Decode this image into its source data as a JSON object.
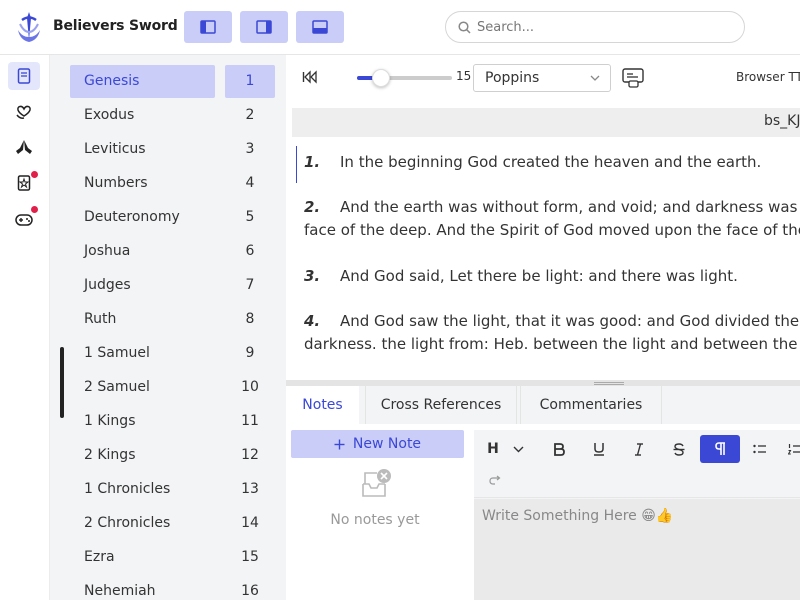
{
  "app": {
    "title": "Believers Sword"
  },
  "search": {
    "placeholder": "Search..."
  },
  "books": [
    {
      "name": "Genesis",
      "num": "1"
    },
    {
      "name": "Exodus",
      "num": "2"
    },
    {
      "name": "Leviticus",
      "num": "3"
    },
    {
      "name": "Numbers",
      "num": "4"
    },
    {
      "name": "Deuteronomy",
      "num": "5"
    },
    {
      "name": "Joshua",
      "num": "6"
    },
    {
      "name": "Judges",
      "num": "7"
    },
    {
      "name": "Ruth",
      "num": "8"
    },
    {
      "name": "1 Samuel",
      "num": "9"
    },
    {
      "name": "2 Samuel",
      "num": "10"
    },
    {
      "name": "1 Kings",
      "num": "11"
    },
    {
      "name": "2 Kings",
      "num": "12"
    },
    {
      "name": "1 Chronicles",
      "num": "13"
    },
    {
      "name": "2 Chronicles",
      "num": "14"
    },
    {
      "name": "Ezra",
      "num": "15"
    },
    {
      "name": "Nehemiah",
      "num": "16"
    }
  ],
  "reader": {
    "font_size": "15",
    "font_size_fraction": 0.25,
    "font_family": "Poppins",
    "tts_label": "Browser TTS",
    "version": "bs_KJV"
  },
  "verses": [
    {
      "num": "1.",
      "line1": "In the beginning God created the heaven and the earth."
    },
    {
      "num": "2.",
      "line1": "And the earth was without form, and void; and darkness was upon the",
      "line2": "face of the deep. And the Spirit of God moved upon the face of the waters."
    },
    {
      "num": "3.",
      "line1": "And God said, Let there be light: and there was light."
    },
    {
      "num": "4.",
      "line1": "And God saw the light, that it was good: and God divided the light from the",
      "line2": "darkness. the light from: Heb. between the light and between the darkness"
    }
  ],
  "tabs": {
    "notes": "Notes",
    "cross_references": "Cross References",
    "commentaries": "Commentaries"
  },
  "notes": {
    "new_note": "New Note",
    "empty": "No notes yet"
  },
  "editor": {
    "heading": "H",
    "placeholder": "Write Something Here 😁👍"
  },
  "icons": {
    "rail": [
      "bible-icon",
      "heart-hands-icon",
      "praying-hands-icon",
      "bookmark-star-icon",
      "gamepad-icon"
    ]
  },
  "colors": {
    "accent": "#3b48d6",
    "accent_light": "#c9cdf7",
    "badge": "#e0204a"
  }
}
